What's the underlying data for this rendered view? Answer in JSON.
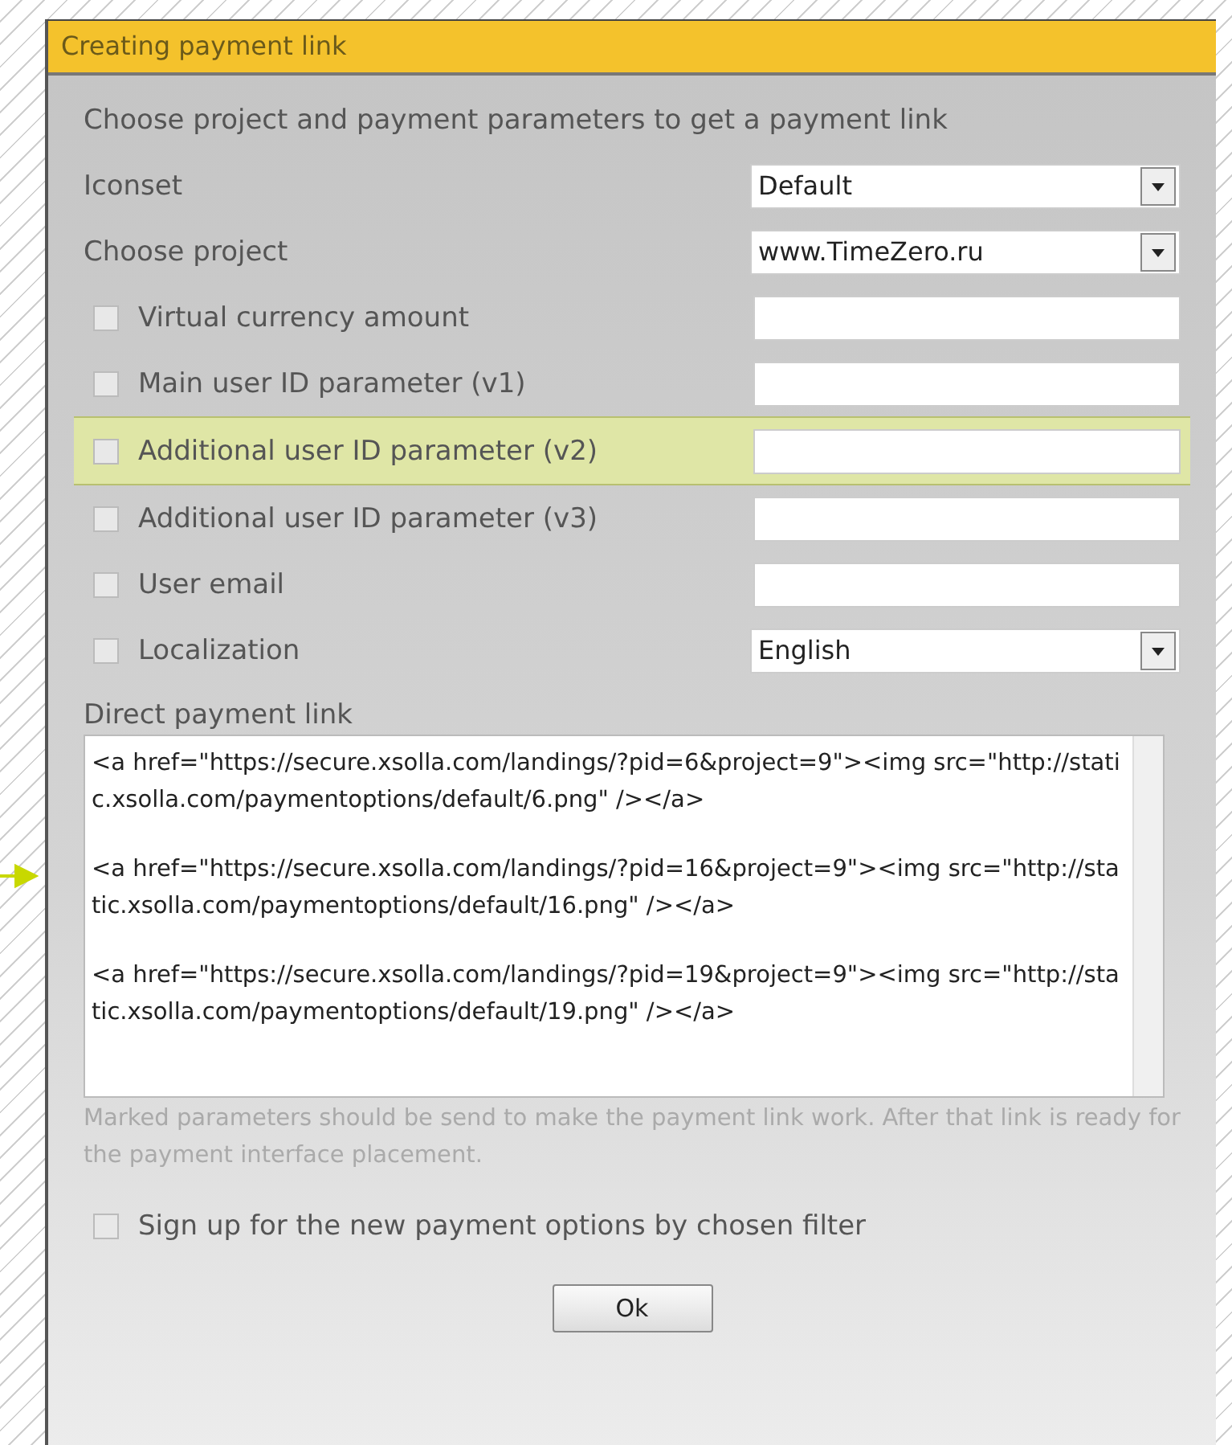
{
  "window": {
    "title": "Creating payment link"
  },
  "intro": "Choose project and payment parameters to get a payment link",
  "rows": [
    {
      "kind": "select",
      "label": "Iconset",
      "value": "Default"
    },
    {
      "kind": "select",
      "label": "Choose project",
      "value": "www.TimeZero.ru"
    },
    {
      "kind": "checkbox-field",
      "label": "Virtual currency amount",
      "checked": false,
      "highlighted": false
    },
    {
      "kind": "checkbox-field",
      "label": "Main user ID parameter (v1)",
      "checked": false,
      "highlighted": false
    },
    {
      "kind": "checkbox-field",
      "label": "Additional user ID parameter (v2)",
      "checked": false,
      "highlighted": true
    },
    {
      "kind": "checkbox-field",
      "label": "Additional user ID parameter (v3)",
      "checked": false,
      "highlighted": false
    },
    {
      "kind": "checkbox-field",
      "label": "User email",
      "checked": false,
      "highlighted": false
    },
    {
      "kind": "checkbox-select",
      "label": "Localization",
      "checked": false,
      "value": "English"
    }
  ],
  "link_box": {
    "label": "Direct payment link",
    "lines": [
      "<a href=\"https://secure.xsolla.com/landings/?pid=6&project=9\"><img src=\"http://static.xsolla.com/paymentoptions/default/6.png\" /></a>",
      "<a href=\"https://secure.xsolla.com/landings/?pid=16&project=9\"><img src=\"http://static.xsolla.com/paymentoptions/default/16.png\" /></a>",
      "<a href=\"https://secure.xsolla.com/landings/?pid=19&project=9\"><img src=\"http://static.xsolla.com/paymentoptions/default/19.png\" /></a>"
    ]
  },
  "note": "Marked parameters should be send to make the payment link work. After that link is ready for the payment interface placement.",
  "signup": {
    "label": "Sign up for the new payment options by chosen filter",
    "checked": false
  },
  "buttons": [
    "Ok"
  ]
}
